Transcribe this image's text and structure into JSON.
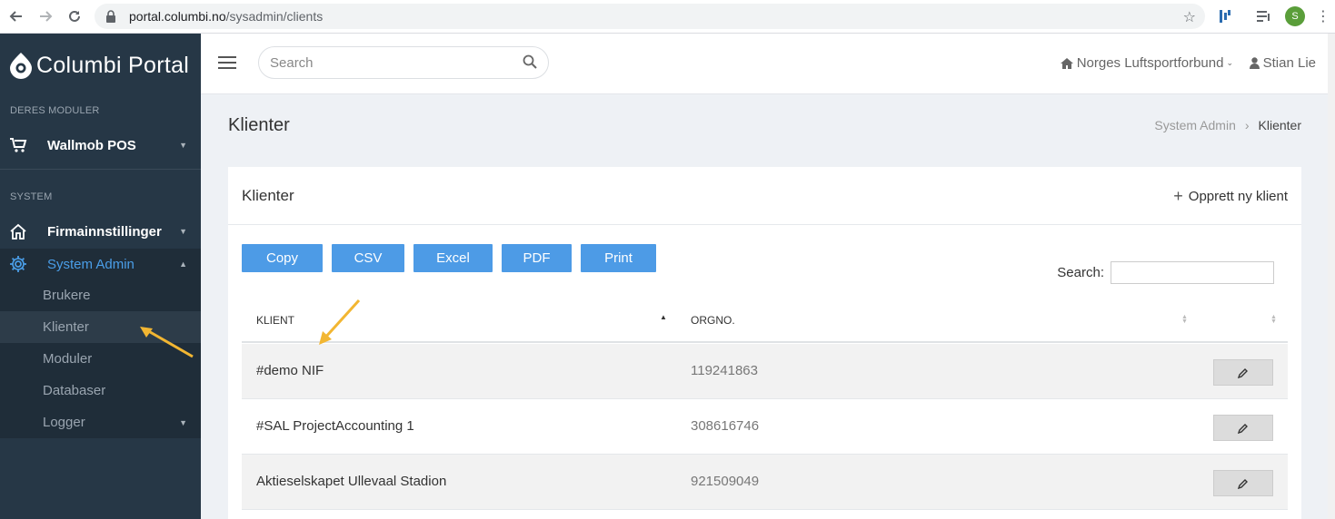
{
  "browser": {
    "url_host": "portal.columbi.no",
    "url_path": "/sysadmin/clients",
    "profile_initial": "S"
  },
  "sidebar": {
    "logo_text": "Columbi Portal",
    "section_modules": "DERES MODULER",
    "module_item": "Wallmob POS",
    "section_system": "SYSTEM",
    "company_settings": "Firmainnstillinger",
    "system_admin": "System Admin",
    "sub_items": [
      {
        "label": "Brukere"
      },
      {
        "label": "Klienter"
      },
      {
        "label": "Moduler"
      },
      {
        "label": "Databaser"
      },
      {
        "label": "Logger"
      }
    ]
  },
  "topbar": {
    "search_placeholder": "Search",
    "organization": "Norges Luftsportforbund",
    "user": "Stian Lie"
  },
  "page": {
    "title": "Klienter",
    "breadcrumb": [
      "System Admin",
      "Klienter"
    ]
  },
  "card": {
    "title": "Klienter",
    "new_button": "Opprett ny klient",
    "export_buttons": [
      "Copy",
      "CSV",
      "Excel",
      "PDF",
      "Print"
    ],
    "search_label": "Search:",
    "columns": [
      "KLIENT",
      "ORGNO."
    ],
    "rows": [
      {
        "name": "#demo NIF",
        "orgno": "119241863"
      },
      {
        "name": "#SAL ProjectAccounting 1",
        "orgno": "308616746"
      },
      {
        "name": "Aktieselskapet Ullevaal Stadion",
        "orgno": "921509049"
      }
    ]
  },
  "colors": {
    "sidebar_bg": "#263746",
    "accent": "#4a9ee8",
    "button_blue": "#4d9be6",
    "annotation_arrow": "#f2b632"
  }
}
